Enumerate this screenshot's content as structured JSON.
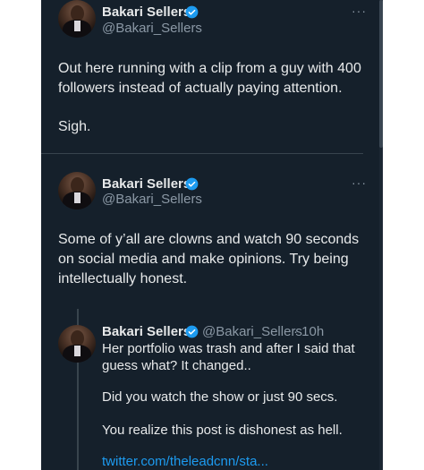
{
  "tweets": [
    {
      "name": "Bakari Sellers",
      "handle": "@Bakari_Sellers",
      "more": "···",
      "paragraphs": [
        "Out here running with a clip from a guy with 400",
        "followers instead of actually paying attention.",
        "Sigh."
      ]
    },
    {
      "name": "Bakari Sellers",
      "handle": "@Bakari_Sellers",
      "more": "···",
      "paragraphs": [
        "Some of y’all are clowns and watch 90 seconds",
        "on social media and make opinions. Try being",
        "intellectually honest."
      ]
    }
  ],
  "quoted": {
    "name": "Bakari Sellers",
    "handle": "@Bakari_Sellers",
    "time": "· 10h",
    "lines": [
      "Her portfolio was trash and after I said that",
      "guess what? It changed..",
      "Did you watch the show or just 90 secs.",
      "You realize this post is dishonest as hell."
    ],
    "link": "twitter.com/theleadcnn/sta..."
  },
  "colors": {
    "background": "#15202b",
    "text": "#e7e9ea",
    "secondary": "#8b98a5",
    "link": "#1d9bf0",
    "verified": "#1d9bf0"
  },
  "icons": [
    "verified-badge-icon",
    "more-options-icon"
  ]
}
